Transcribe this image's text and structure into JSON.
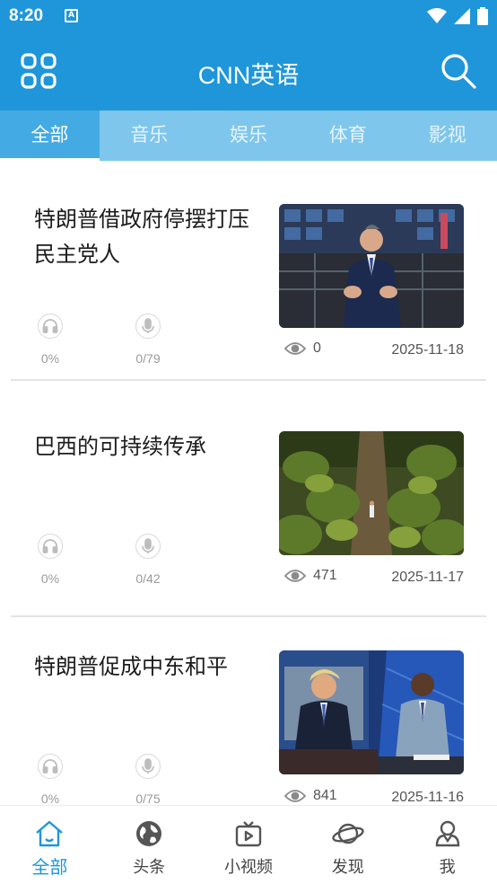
{
  "status_bar": {
    "time": "8:20"
  },
  "header": {
    "title": "CNN英语",
    "menu_icon": "grid-icon",
    "search_icon": "search-icon"
  },
  "tabs": [
    {
      "label": "全部",
      "active": true
    },
    {
      "label": "音乐",
      "active": false
    },
    {
      "label": "娱乐",
      "active": false
    },
    {
      "label": "体育",
      "active": false
    },
    {
      "label": "影视",
      "active": false
    }
  ],
  "articles": [
    {
      "title": "特朗普借政府停摆打压民主党人",
      "listen_progress": "0%",
      "speak_progress": "0/79",
      "views": "0",
      "date": "2025-11-18"
    },
    {
      "title": "巴西的可持续传承",
      "listen_progress": "0%",
      "speak_progress": "0/42",
      "views": "471",
      "date": "2025-11-17"
    },
    {
      "title": "特朗普促成中东和平",
      "listen_progress": "0%",
      "speak_progress": "0/75",
      "views": "841",
      "date": "2025-11-16"
    }
  ],
  "bottom_nav": [
    {
      "label": "全部",
      "icon": "home-icon",
      "active": true
    },
    {
      "label": "头条",
      "icon": "globe-icon",
      "active": false
    },
    {
      "label": "小视频",
      "icon": "tv-icon",
      "active": false
    },
    {
      "label": "发现",
      "icon": "planet-icon",
      "active": false
    },
    {
      "label": "我",
      "icon": "user-icon",
      "active": false
    }
  ],
  "colors": {
    "primary": "#1f96d9",
    "tab_bar": "#7fc6ec",
    "tab_active": "#43aae3"
  }
}
